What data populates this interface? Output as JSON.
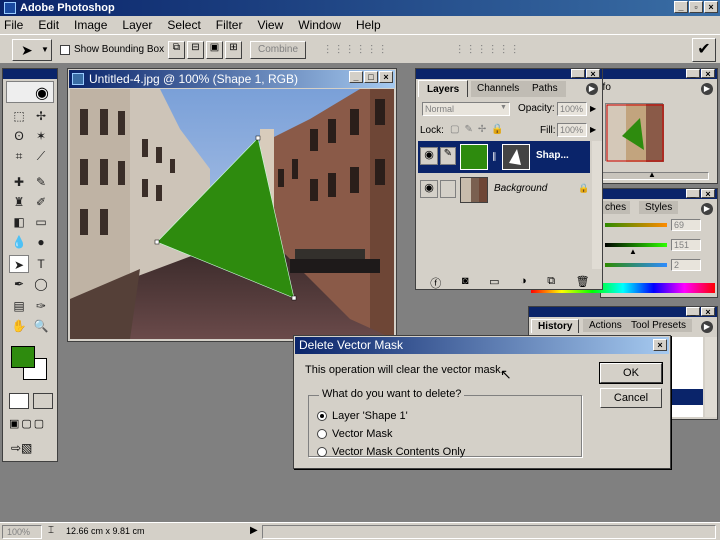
{
  "app": {
    "title": "Adobe Photoshop"
  },
  "menu": [
    "File",
    "Edit",
    "Image",
    "Layer",
    "Select",
    "Filter",
    "View",
    "Window",
    "Help"
  ],
  "options": {
    "show_bounding_box": "Show Bounding Box",
    "combine": "Combine"
  },
  "document": {
    "title": "Untitled-4.jpg @ 100% (Shape 1, RGB)",
    "shape_color": "#2e8b0e"
  },
  "layers_panel": {
    "tabs": [
      "Layers",
      "Channels",
      "Paths"
    ],
    "blend_mode": "Normal",
    "opacity_label": "Opacity:",
    "opacity_value": "100%",
    "lock_label": "Lock:",
    "fill_label": "Fill:",
    "fill_value": "100%",
    "layers": [
      {
        "name": "Shap...",
        "selected": true
      },
      {
        "name": "Background",
        "selected": false
      }
    ]
  },
  "navigator_panel": {
    "tab": "nfo"
  },
  "color_panel": {
    "tabs": [
      "ches",
      "Styles"
    ],
    "values": [
      "69",
      "151",
      "2"
    ]
  },
  "history_panel": {
    "tabs": [
      "History",
      "Actions",
      "Tool Presets"
    ]
  },
  "dialog": {
    "title": "Delete Vector Mask",
    "message": "This operation will clear the vector mask.",
    "group_label": "What do you want to delete?",
    "options": [
      "Layer 'Shape 1'",
      "Vector Mask",
      "Vector Mask Contents Only"
    ],
    "selected_option": 0,
    "ok_label": "OK",
    "cancel_label": "Cancel"
  },
  "status": {
    "zoom": "100%",
    "dimensions": "12.66 cm x 9.81 cm"
  },
  "colors": {
    "foreground": "#2e8b0e",
    "background": "#ffffff",
    "titlebar": "#0a246a"
  }
}
